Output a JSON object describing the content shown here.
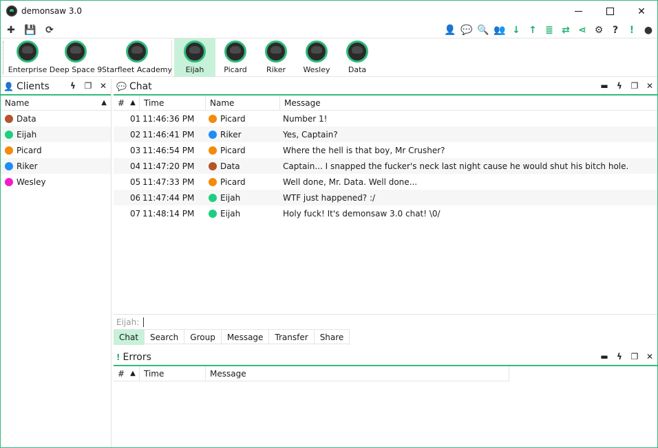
{
  "window": {
    "title": "demonsaw 3.0",
    "accent": "#2fba7c"
  },
  "toolbar": {
    "left": [
      {
        "icon": "plus-icon",
        "glyph": "✚"
      },
      {
        "icon": "save-icon",
        "glyph": "💾"
      },
      {
        "icon": "refresh-icon",
        "glyph": "⟳"
      }
    ],
    "right": [
      {
        "icon": "user-icon",
        "glyph": "👤"
      },
      {
        "icon": "chat-icon",
        "glyph": "💬"
      },
      {
        "icon": "search-icon",
        "glyph": "🔍"
      },
      {
        "icon": "group-icon",
        "glyph": "👥"
      },
      {
        "icon": "download-icon",
        "glyph": "↓"
      },
      {
        "icon": "upload-icon",
        "glyph": "↑"
      },
      {
        "icon": "list-icon",
        "glyph": "≣"
      },
      {
        "icon": "transfer-icon",
        "glyph": "⇄"
      },
      {
        "icon": "share-icon",
        "glyph": "⋖"
      },
      {
        "icon": "gear-icon",
        "glyph": "⚙"
      },
      {
        "icon": "help-icon",
        "glyph": "?"
      },
      {
        "icon": "alert-icon",
        "glyph": "!"
      },
      {
        "icon": "profile-icon",
        "glyph": "●"
      }
    ]
  },
  "routers": [
    {
      "label": "Enterprise"
    },
    {
      "label": "Deep Space 9"
    },
    {
      "label": "Starfleet Academy"
    }
  ],
  "identities": [
    {
      "label": "Eijah",
      "active": true
    },
    {
      "label": "Picard"
    },
    {
      "label": "Riker"
    },
    {
      "label": "Wesley"
    },
    {
      "label": "Data"
    }
  ],
  "clients": {
    "title": "Clients",
    "column": "Name",
    "items": [
      {
        "name": "Data",
        "color": "#b5542a"
      },
      {
        "name": "Eijah",
        "color": "#1fcf80"
      },
      {
        "name": "Picard",
        "color": "#f58a0b"
      },
      {
        "name": "Riker",
        "color": "#1e8ef5"
      },
      {
        "name": "Wesley",
        "color": "#f21bc9"
      }
    ]
  },
  "chat": {
    "title": "Chat",
    "columns": {
      "num": "#",
      "time": "Time",
      "name": "Name",
      "message": "Message"
    },
    "rows": [
      {
        "num": "01",
        "time": "11:46:36 PM",
        "name": "Picard",
        "color": "#f58a0b",
        "message": "Number 1!"
      },
      {
        "num": "02",
        "time": "11:46:41 PM",
        "name": "Riker",
        "color": "#1e8ef5",
        "message": "Yes, Captain?"
      },
      {
        "num": "03",
        "time": "11:46:54 PM",
        "name": "Picard",
        "color": "#f58a0b",
        "message": "Where the hell is that boy, Mr Crusher?"
      },
      {
        "num": "04",
        "time": "11:47:20 PM",
        "name": "Data",
        "color": "#b5542a",
        "message": "Captain... I snapped the fucker's neck last night cause he would shut his bitch hole."
      },
      {
        "num": "05",
        "time": "11:47:33 PM",
        "name": "Picard",
        "color": "#f58a0b",
        "message": "Well done, Mr. Data. Well done..."
      },
      {
        "num": "06",
        "time": "11:47:44 PM",
        "name": "Eijah",
        "color": "#1fcf80",
        "message": "WTF just happened? :/"
      },
      {
        "num": "07",
        "time": "11:48:14 PM",
        "name": "Eijah",
        "color": "#1fcf80",
        "message": "Holy fuck! It's demonsaw 3.0 chat!  \\0/"
      }
    ],
    "input_label": "Eijah:",
    "input_value": "",
    "tabs": [
      "Chat",
      "Search",
      "Group",
      "Message",
      "Transfer",
      "Share"
    ],
    "active_tab": "Chat"
  },
  "errors": {
    "title": "Errors",
    "columns": {
      "num": "#",
      "time": "Time",
      "message": "Message"
    }
  }
}
